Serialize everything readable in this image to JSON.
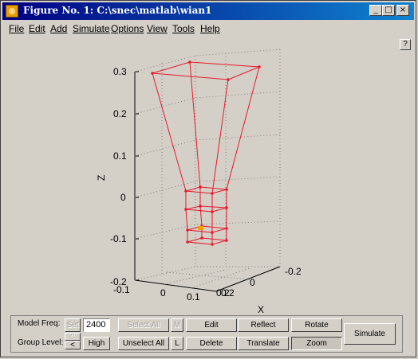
{
  "window": {
    "title": "Figure No. 1: C:\\snec\\matlab\\wian1",
    "controls": [
      "_",
      "□",
      "×"
    ]
  },
  "menu": [
    "File",
    "Edit",
    "Add",
    "Simulate",
    "Options",
    "View",
    "Tools",
    "Help"
  ],
  "help_button": "?",
  "plot": {
    "zlabel": "Z",
    "xlabel": "X",
    "z_ticks": [
      "0.3",
      "0.2",
      "0.1",
      "0",
      "-0.1",
      "-0.2"
    ],
    "x_ticks": [
      "-0.1",
      "0",
      "0.1",
      "0.2"
    ],
    "y_ticks": [
      "-0.2",
      "0",
      "0.2"
    ],
    "wire_color": "#e8192c",
    "feed_color": "#f0a000"
  },
  "controls": {
    "model_freq_label": "Model Freq:",
    "set_label": "Set",
    "freq_value": "2400",
    "group_level_label": "Group Level:",
    "group_up": "^",
    "group_down": "<",
    "high_label": "High",
    "select_all": "Select All",
    "m_label": "M",
    "unselect_all": "Unselect All",
    "l_label": "L",
    "edit": "Edit",
    "delete": "Delete",
    "reflect": "Reflect",
    "translate": "Translate",
    "rotate": "Rotate",
    "zoom": "Zoom",
    "simulate": "Simulate"
  }
}
